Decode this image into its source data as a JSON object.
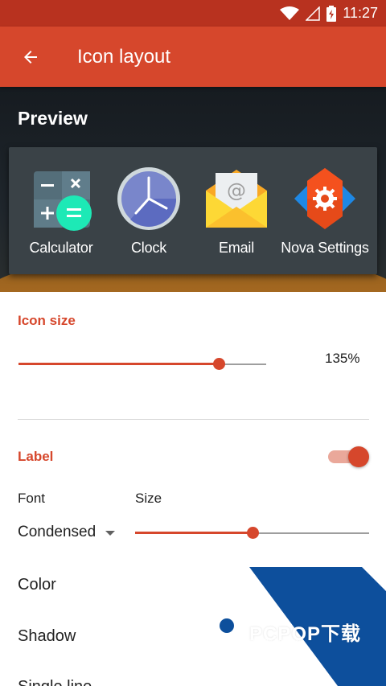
{
  "status_bar": {
    "time": "11:27",
    "icons": [
      "wifi-icon",
      "signal-icon",
      "battery-icon"
    ]
  },
  "app_bar": {
    "title": "Icon layout",
    "back_icon": "arrow-back-icon"
  },
  "preview": {
    "title": "Preview",
    "apps": [
      {
        "label": "Calculator",
        "icon": "calculator-icon"
      },
      {
        "label": "Clock",
        "icon": "clock-icon"
      },
      {
        "label": "Email",
        "icon": "email-icon"
      },
      {
        "label": "Nova Settings",
        "icon": "nova-settings-icon"
      }
    ]
  },
  "icon_size": {
    "title": "Icon size",
    "value_text": "135%",
    "slider_fraction": 0.81
  },
  "label": {
    "title": "Label",
    "enabled": true,
    "font_label": "Font",
    "font_value": "Condensed",
    "size_label": "Size",
    "size_fraction": 0.5
  },
  "rows": {
    "color": "Color",
    "shadow": "Shadow",
    "single_line": "Single line"
  },
  "watermark": {
    "brand": "PCPOP下载",
    "sub": "PCPOP Download"
  },
  "colors": {
    "accent": "#d6472c",
    "status_bar": "#b8321f",
    "dock": "#3a4247"
  }
}
